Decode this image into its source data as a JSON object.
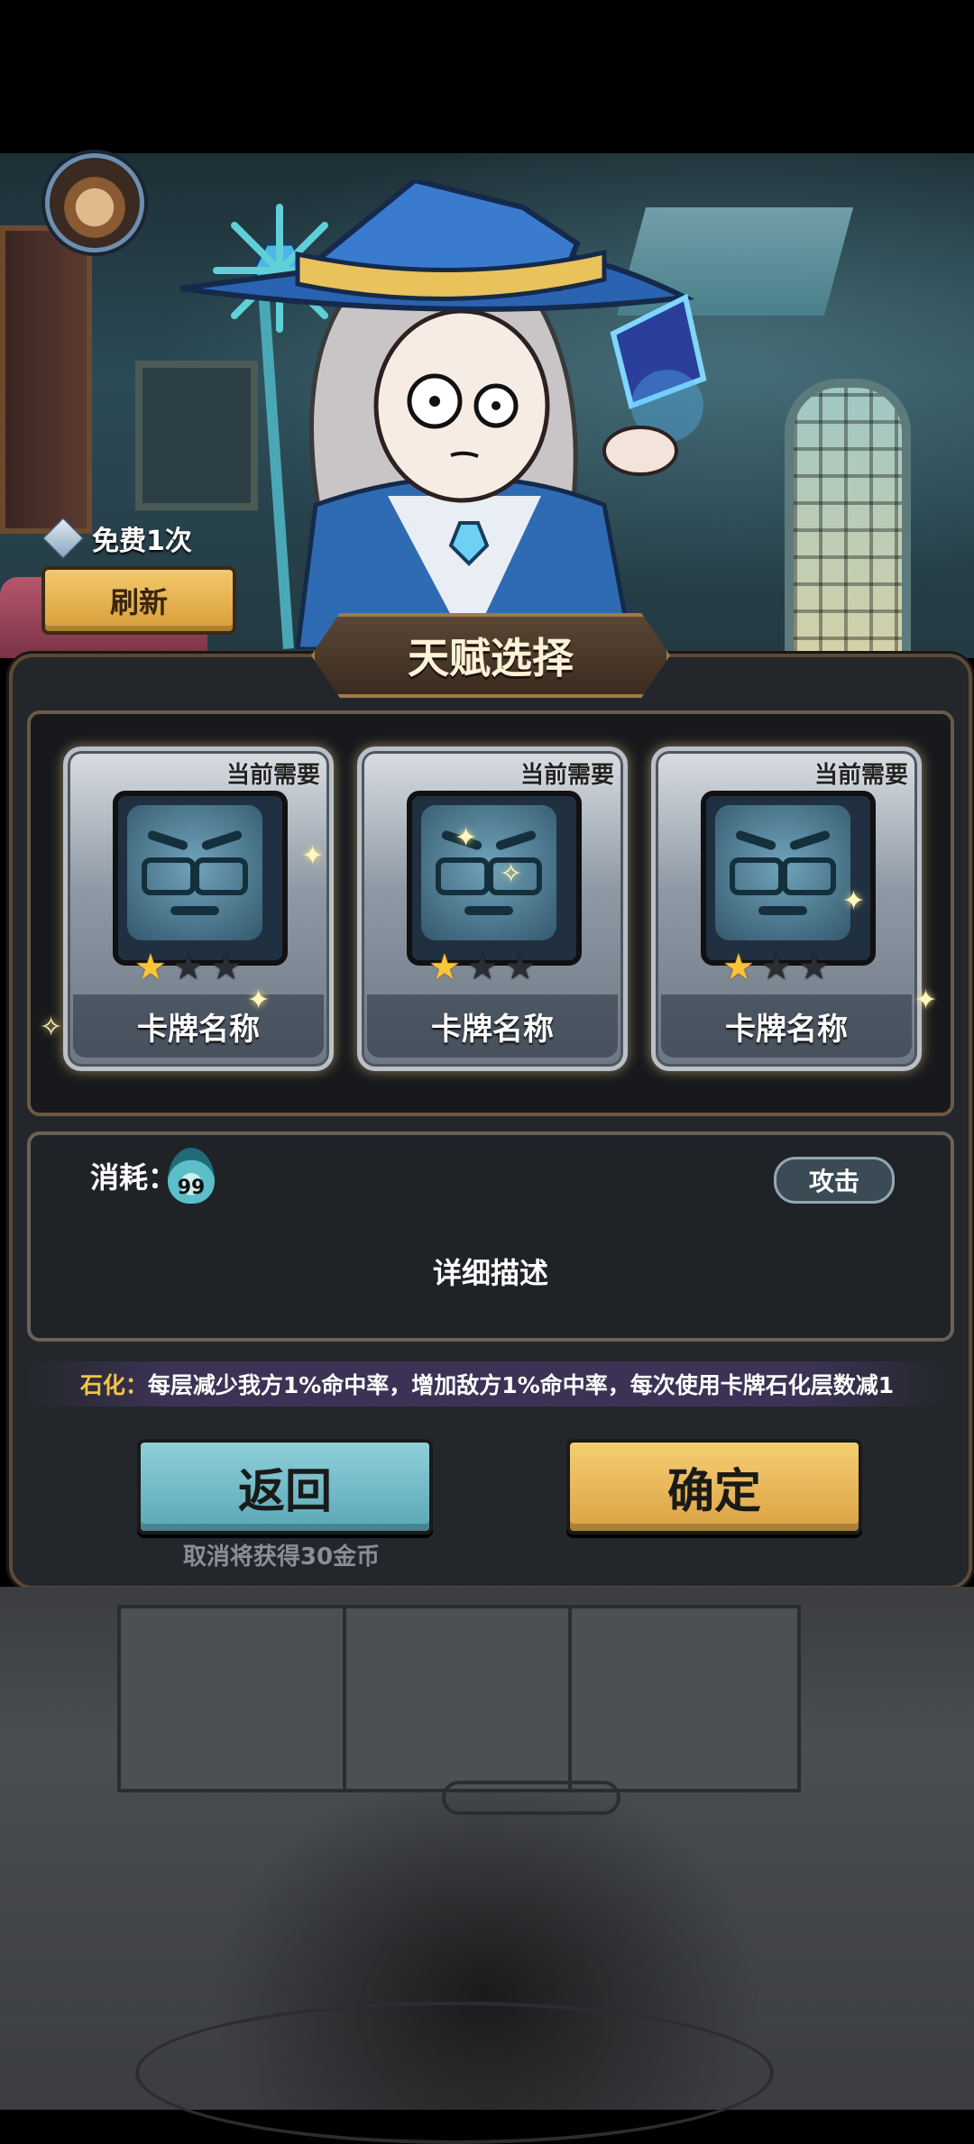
{
  "refresh": {
    "free_text": "免费1次",
    "button_label": "刷新"
  },
  "panel": {
    "title": "天赋选择"
  },
  "cards": [
    {
      "need_label": "当前需要",
      "name": "卡牌名称",
      "stars_total": 3,
      "stars_filled": 1
    },
    {
      "need_label": "当前需要",
      "name": "卡牌名称",
      "stars_total": 3,
      "stars_filled": 1
    },
    {
      "need_label": "当前需要",
      "name": "卡牌名称",
      "stars_total": 3,
      "stars_filled": 1
    }
  ],
  "details": {
    "cost_label": "消耗：",
    "cost_value": "99",
    "type_tag": "攻击",
    "description": "详细描述"
  },
  "petrify": {
    "key": "石化：",
    "text": "每层减少我方1%命中率，增加敌方1%命中率，每次使用卡牌石化层数减1"
  },
  "buttons": {
    "back_label": "返回",
    "confirm_label": "确定",
    "cancel_hint": "取消将获得30金币"
  },
  "colors": {
    "back_button": "#6dbcc9",
    "confirm_button": "#e8b655",
    "star_on": "#f7c43a",
    "key_highlight": "#f4c542"
  },
  "icons": [
    "avatar",
    "cube-icon",
    "star-icon",
    "flame-icon",
    "sparkle-icon"
  ]
}
